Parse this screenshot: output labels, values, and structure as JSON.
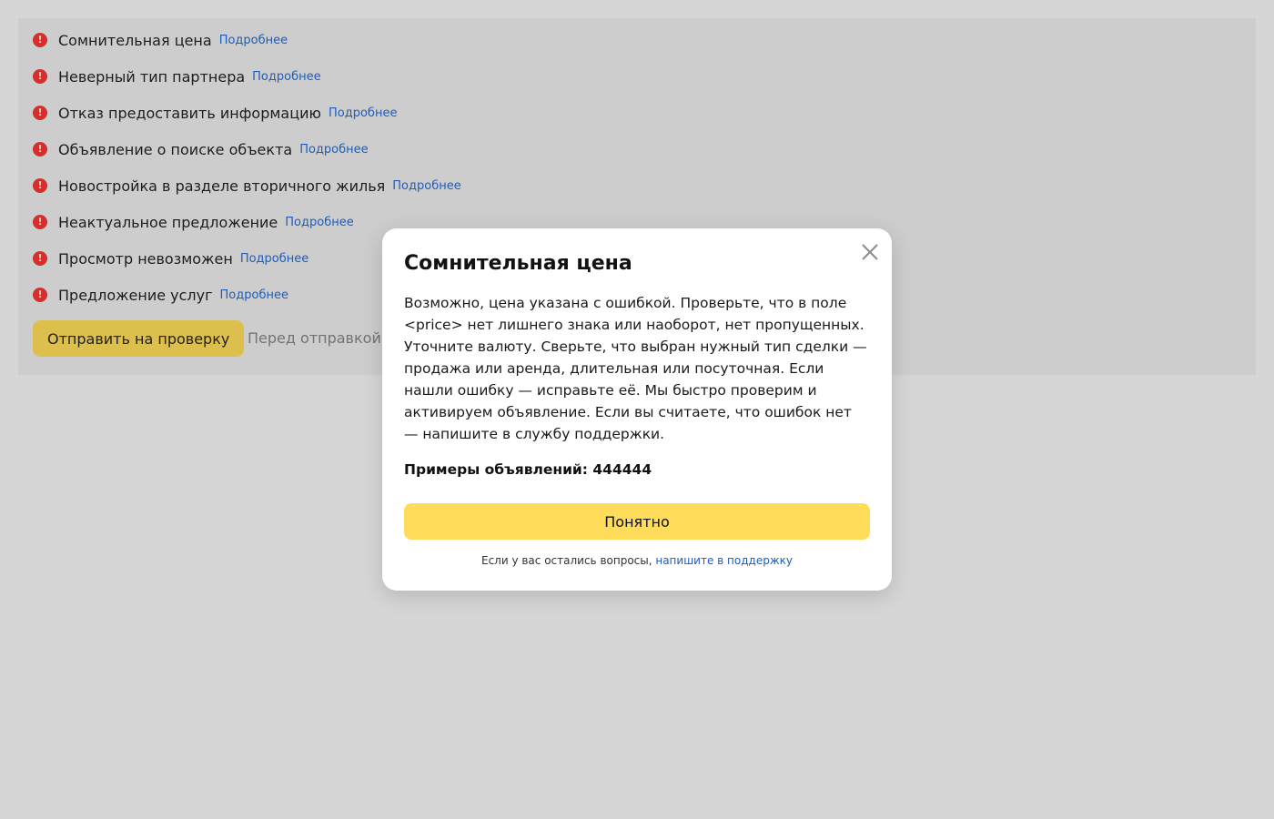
{
  "issues": [
    {
      "title": "Сомнительная цена",
      "link": "Подробнее"
    },
    {
      "title": "Неверный тип партнера",
      "link": "Подробнее"
    },
    {
      "title": "Отказ предоставить информацию",
      "link": "Подробнее"
    },
    {
      "title": "Объявление о поиске объекта",
      "link": "Подробнее"
    },
    {
      "title": "Новостройка в разделе вторичного жилья",
      "link": "Подробнее"
    },
    {
      "title": "Неактуальное предложение",
      "link": "Подробнее"
    },
    {
      "title": "Просмотр невозможен",
      "link": "Подробнее"
    },
    {
      "title": "Предложение услуг",
      "link": "Подробнее"
    }
  ],
  "issue_icon": {
    "name": "exclamation-icon",
    "glyph": "!",
    "color": "#d5302b"
  },
  "actions": {
    "submit_label": "Отправить на проверку",
    "submit_note": "Перед отправкой на"
  },
  "modal": {
    "title": "Сомнительная цена",
    "body": "Возможно, цена указана с ошибкой. Проверьте, что в поле <price> нет лишнего знака или наоборот, нет пропущенных. Уточните валюту. Сверьте, что выбран нужный тип сделки — продажа или аренда, длительная или посуточная. Если нашли ошибку — исправьте её. Мы быстро проверим и активируем объявление. Если вы считаете, что ошибок нет — напишите в службу поддержки.",
    "examples": "Примеры объявлений: 444444",
    "ok_label": "Понятно",
    "footer_text": "Если у вас остались вопросы, ",
    "footer_link": "напишите в поддержку"
  },
  "colors": {
    "background": "#d6d6d6",
    "link": "#1e5dbd",
    "primary_button": "#ffdd5a",
    "error": "#d5302b"
  }
}
